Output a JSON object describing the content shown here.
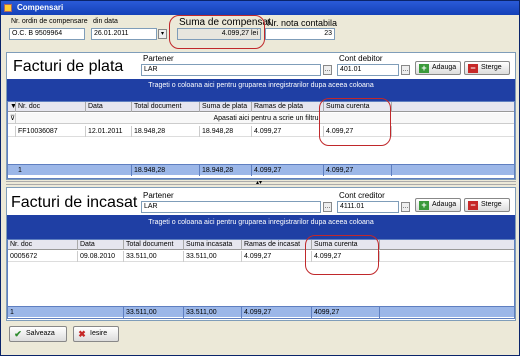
{
  "window": {
    "title": "Compensari"
  },
  "header": {
    "order_label": "Nr. ordin de compensare",
    "order_value": "O.C. B 9509964",
    "date_label": "din data",
    "date_value": "26.01.2011",
    "sum_label": "Suma de compensat",
    "sum_value": "4.099,27 lei",
    "nota_label": "Nr. nota contabila",
    "nota_value": "23"
  },
  "plata": {
    "title": "Facturi de plata",
    "partner_label": "Partener",
    "partner_value": "LAR",
    "cont_label": "Cont debitor",
    "cont_value": "401.01",
    "add_label": "Adauga",
    "delete_label": "Sterge",
    "group_hint": "Trageti o coloana aici pentru gruparea inregistrarilor dupa aceea coloana",
    "columns": [
      "Nr. doc",
      "Data",
      "Total document",
      "Suma de plata",
      "Ramas de plata",
      "Suma curenta"
    ],
    "filter_hint": "Apasati aici pentru a scrie un filtru",
    "rows": [
      [
        "FF10036087",
        "12.01.2011",
        "18.948,28",
        "18.948,28",
        "4.099,27",
        "4.099,27"
      ]
    ],
    "totals": [
      "1",
      "",
      "18.948,28",
      "18.948,28",
      "4.099,27",
      "4.099,27"
    ]
  },
  "incasat": {
    "title": "Facturi de incasat",
    "partner_label": "Partener",
    "partner_value": "LAR",
    "cont_label": "Cont creditor",
    "cont_value": "4111.01",
    "add_label": "Adauga",
    "delete_label": "Sterge",
    "group_hint": "Trageti o coloana aici pentru gruparea inregistrarilor dupa aceea coloana",
    "columns": [
      "Nr. doc",
      "Data",
      "Total document",
      "Suma incasata",
      "Ramas de incasat",
      "Suma curenta"
    ],
    "rows": [
      [
        "0005672",
        "09.08.2010",
        "33.511,00",
        "33.511,00",
        "4.099,27",
        "4.099,27"
      ]
    ],
    "totals": [
      "1",
      "",
      "33.511,00",
      "33.511,00",
      "4.099,27",
      "4099,27"
    ]
  },
  "footer": {
    "save_label": "Salveaza",
    "exit_label": "Iesire"
  },
  "colors": {
    "accent": "#1f3fa4",
    "highlight": "#c0282b",
    "totals": "#9cb7e8"
  }
}
